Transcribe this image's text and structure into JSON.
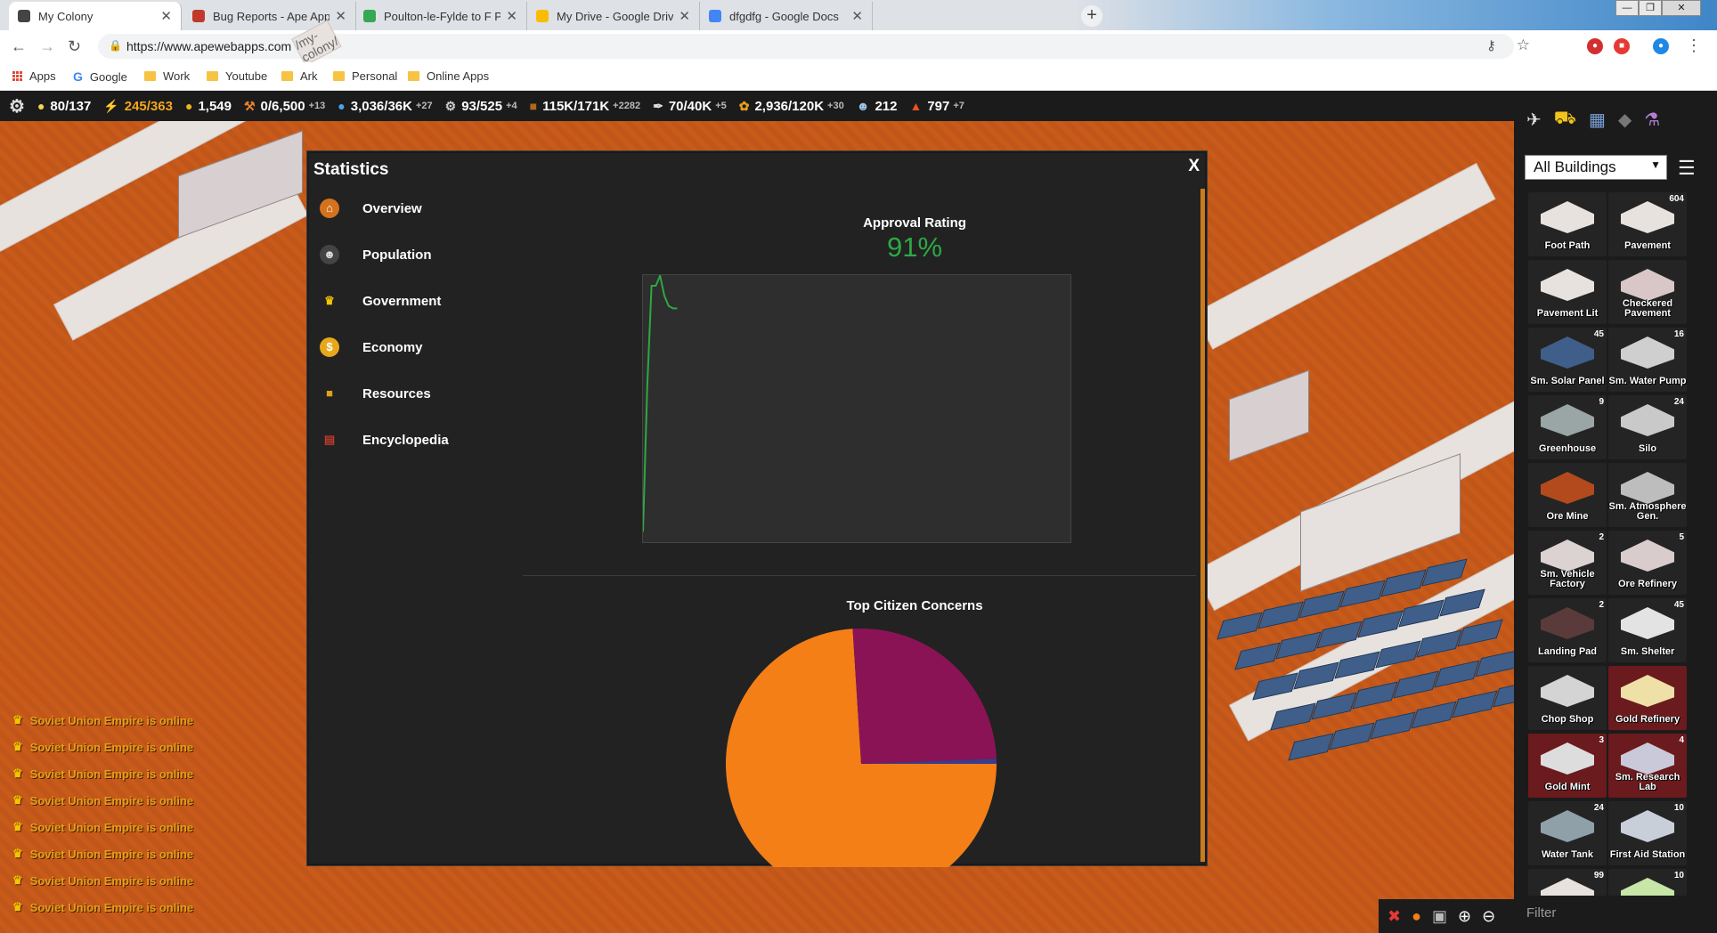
{
  "browser": {
    "tabs": [
      {
        "title": "My Colony",
        "active": true
      },
      {
        "title": "Bug Reports - Ape Apps",
        "active": false
      },
      {
        "title": "Poulton-le-Fylde to F Parkinson L",
        "active": false
      },
      {
        "title": "My Drive - Google Drive",
        "active": false
      },
      {
        "title": "dfgdfg - Google Docs",
        "active": false
      }
    ],
    "url_host": "https://www.apewebapps.com",
    "url_path": "/my-colony/",
    "bookmarks": [
      "Apps",
      "Google",
      "Work",
      "Youtube",
      "Ark",
      "Personal",
      "Online Apps"
    ]
  },
  "resources": [
    {
      "icon": "bulb-icon",
      "value": "80/137",
      "color": "#ffffff",
      "delta": ""
    },
    {
      "icon": "lightning-icon",
      "value": "245/363",
      "color": "#f0a71c",
      "delta": ""
    },
    {
      "icon": "coin-icon",
      "value": "1,549",
      "color": "#ffffff",
      "delta": ""
    },
    {
      "icon": "wrench-icon",
      "value": "0/6,500",
      "color": "#ffffff",
      "delta": "+13"
    },
    {
      "icon": "water-drop-icon",
      "value": "3,036/36K",
      "color": "#ffffff",
      "delta": "+27"
    },
    {
      "icon": "gear-small-icon",
      "value": "93/525",
      "color": "#ffffff",
      "delta": "+4"
    },
    {
      "icon": "ore-icon",
      "value": "115K/171K",
      "color": "#ffffff",
      "delta": "+2282"
    },
    {
      "icon": "feather-icon",
      "value": "70/40K",
      "color": "#ffffff",
      "delta": "+5"
    },
    {
      "icon": "food-icon",
      "value": "2,936/120K",
      "color": "#ffffff",
      "delta": "+30"
    },
    {
      "icon": "people-icon",
      "value": "212",
      "color": "#ffffff",
      "delta": ""
    },
    {
      "icon": "fire-icon",
      "value": "797",
      "color": "#ffffff",
      "delta": "+7"
    }
  ],
  "statistics": {
    "title": "Statistics",
    "close_label": "X",
    "nav": [
      {
        "label": "Overview",
        "icon": "home-icon",
        "color": "#d5721c"
      },
      {
        "label": "Population",
        "icon": "people-icon",
        "color": "#444444"
      },
      {
        "label": "Government",
        "icon": "crown-icon",
        "color": "#222222"
      },
      {
        "label": "Economy",
        "icon": "coin-icon",
        "color": "#e8a81c"
      },
      {
        "label": "Resources",
        "icon": "ore-icon",
        "color": "#222222"
      },
      {
        "label": "Encyclopedia",
        "icon": "book-icon",
        "color": "#222222"
      }
    ],
    "approval_title": "Approval Rating",
    "approval_value": "91%",
    "concerns_title": "Top Citizen Concerns"
  },
  "chart_data": [
    {
      "type": "line",
      "title": "Approval Rating",
      "x": [
        0,
        1,
        2,
        3,
        4,
        5,
        6,
        7,
        8
      ],
      "series": [
        {
          "values": [
            2,
            60,
            100,
            100,
            104,
            96,
            92,
            91,
            91
          ]
        }
      ],
      "xlim": [
        0,
        100
      ],
      "ylim": [
        0,
        100
      ],
      "grid": false,
      "color": "#2ea843"
    },
    {
      "type": "pie",
      "title": "Top Citizen Concerns",
      "slices": [
        {
          "value": 74,
          "color": "#f47f17"
        },
        {
          "value": 25.4,
          "color": "#8a1356"
        },
        {
          "value": 0.6,
          "color": "#3b3b8e"
        }
      ]
    }
  ],
  "sidebar": {
    "select_value": "All Buildings",
    "filter_placeholder": "Filter",
    "buildings": [
      {
        "name": "Foot Path",
        "count": "",
        "red": false,
        "color": "#e8e2df"
      },
      {
        "name": "Pavement",
        "count": "604",
        "red": false,
        "color": "#e8e2df"
      },
      {
        "name": "Pavement Lit",
        "count": "",
        "red": false,
        "color": "#e8e2df"
      },
      {
        "name": "Checkered Pavement",
        "count": "",
        "red": false,
        "color": "#d9c6c6"
      },
      {
        "name": "Sm. Solar Panel",
        "count": "45",
        "red": false,
        "color": "#3f5e8a"
      },
      {
        "name": "Sm. Water Pump",
        "count": "16",
        "red": false,
        "color": "#cfcfcf"
      },
      {
        "name": "Greenhouse",
        "count": "9",
        "red": false,
        "color": "#9aa5a6"
      },
      {
        "name": "Silo",
        "count": "24",
        "red": false,
        "color": "#c9c9c9"
      },
      {
        "name": "Ore Mine",
        "count": "",
        "red": false,
        "color": "#b24a1d"
      },
      {
        "name": "Sm. Atmosphere Gen.",
        "count": "",
        "red": false,
        "color": "#bdbdbd"
      },
      {
        "name": "Sm. Vehicle Factory",
        "count": "2",
        "red": false,
        "color": "#ddd2d2"
      },
      {
        "name": "Ore Refinery",
        "count": "5",
        "red": false,
        "color": "#d9cccc"
      },
      {
        "name": "Landing Pad",
        "count": "2",
        "red": false,
        "color": "#5a3a3a"
      },
      {
        "name": "Sm. Shelter",
        "count": "45",
        "red": false,
        "color": "#e3e3e3"
      },
      {
        "name": "Chop Shop",
        "count": "",
        "red": false,
        "color": "#d4d4d4"
      },
      {
        "name": "Gold Refinery",
        "count": "",
        "red": true,
        "color": "#efe0a8"
      },
      {
        "name": "Gold Mint",
        "count": "3",
        "red": true,
        "color": "#dddddd"
      },
      {
        "name": "Sm. Research Lab",
        "count": "4",
        "red": true,
        "color": "#c9c9d9"
      },
      {
        "name": "Water Tank",
        "count": "24",
        "red": false,
        "color": "#8fa0a8"
      },
      {
        "name": "First Aid Station",
        "count": "10",
        "red": false,
        "color": "#c9cfd9"
      },
      {
        "name": "",
        "count": "99",
        "red": false,
        "color": "#e8e2df"
      },
      {
        "name": "",
        "count": "10",
        "red": false,
        "color": "#c7e6a8"
      }
    ]
  },
  "chat": [
    "Soviet Union Empire is online",
    "Soviet Union Empire is online",
    "Soviet Union Empire is online",
    "Soviet Union Empire is online",
    "Soviet Union Empire is online",
    "Soviet Union Empire is online",
    "Soviet Union Empire is online",
    "Soviet Union Empire is online"
  ]
}
